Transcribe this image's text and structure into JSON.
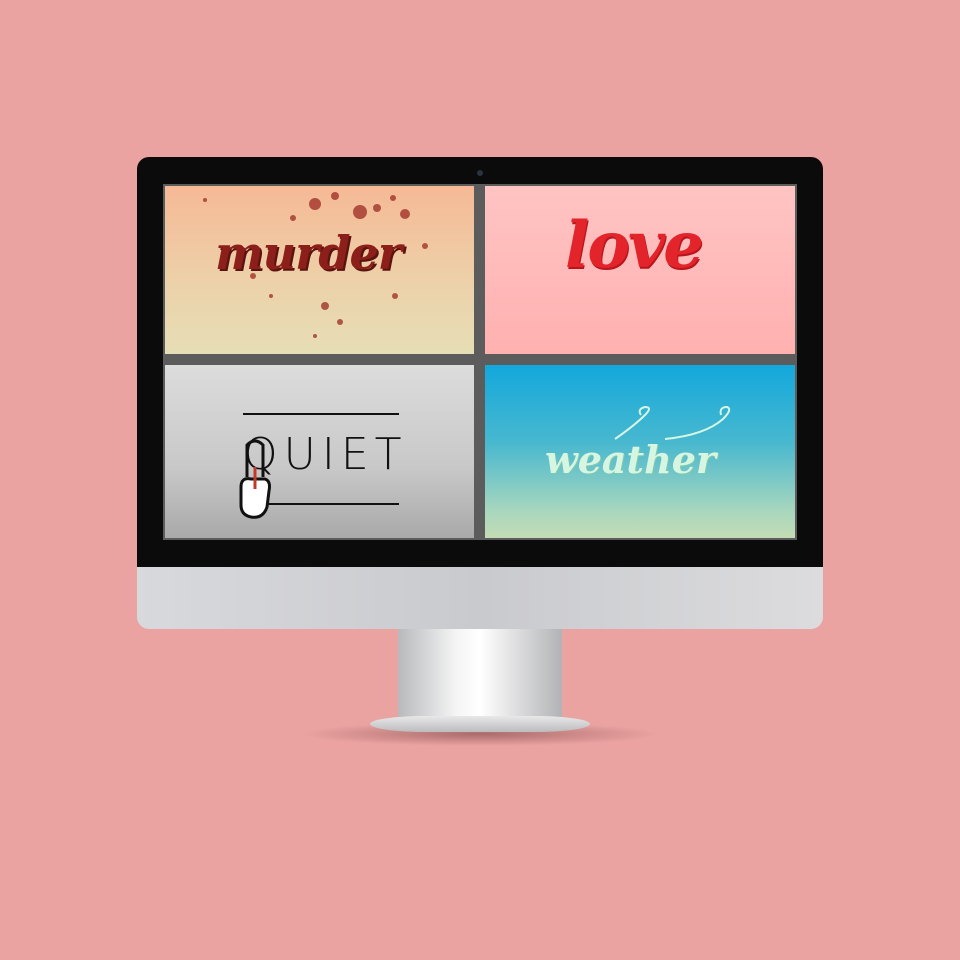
{
  "background_color": "#eaa3a1",
  "screen": {
    "tiles": [
      {
        "word": "murder",
        "text_color": "#8d1f1a"
      },
      {
        "word": "love",
        "text_color": "#e3242b"
      },
      {
        "word": "QUIET",
        "text_color": "#111111"
      },
      {
        "word": "weather",
        "text_color": "#d7f6e1"
      }
    ]
  }
}
